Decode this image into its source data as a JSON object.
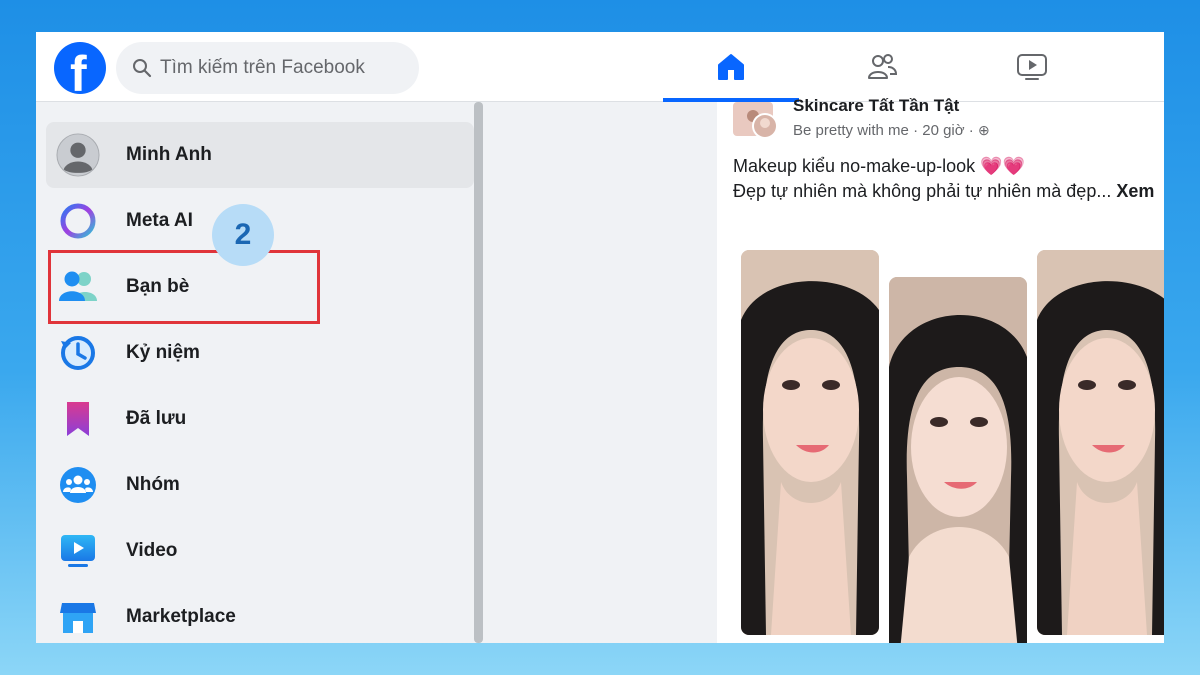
{
  "search": {
    "placeholder": "Tìm kiếm trên Facebook"
  },
  "nav": {
    "tabs": [
      {
        "name": "home",
        "icon": "home-icon",
        "active": true
      },
      {
        "name": "friends",
        "icon": "friends-icon",
        "active": false
      },
      {
        "name": "watch",
        "icon": "video-icon",
        "active": false
      }
    ]
  },
  "sidebar": {
    "items": [
      {
        "label": "Minh Anh",
        "icon": "avatar"
      },
      {
        "label": "Meta AI",
        "icon": "meta-ai-icon"
      },
      {
        "label": "Bạn bè",
        "icon": "friends-icon"
      },
      {
        "label": "Kỷ niệm",
        "icon": "memories-icon"
      },
      {
        "label": "Đã lưu",
        "icon": "saved-icon"
      },
      {
        "label": "Nhóm",
        "icon": "groups-icon"
      },
      {
        "label": "Video",
        "icon": "video-icon"
      },
      {
        "label": "Marketplace",
        "icon": "marketplace-icon"
      }
    ]
  },
  "annotation": {
    "step": "2"
  },
  "post": {
    "title": "Skincare Tất Tần Tật",
    "author": "Be pretty with me",
    "time": "20 giờ",
    "line1": "Makeup kiểu no-make-up-look 💗💗",
    "line2": "Đẹp tự nhiên mà không phải tự nhiên mà đẹp...",
    "see_more": "Xem"
  },
  "colors": {
    "brand": "#0866ff",
    "highlight": "#e0343a",
    "badge": "#b7dcf7"
  }
}
